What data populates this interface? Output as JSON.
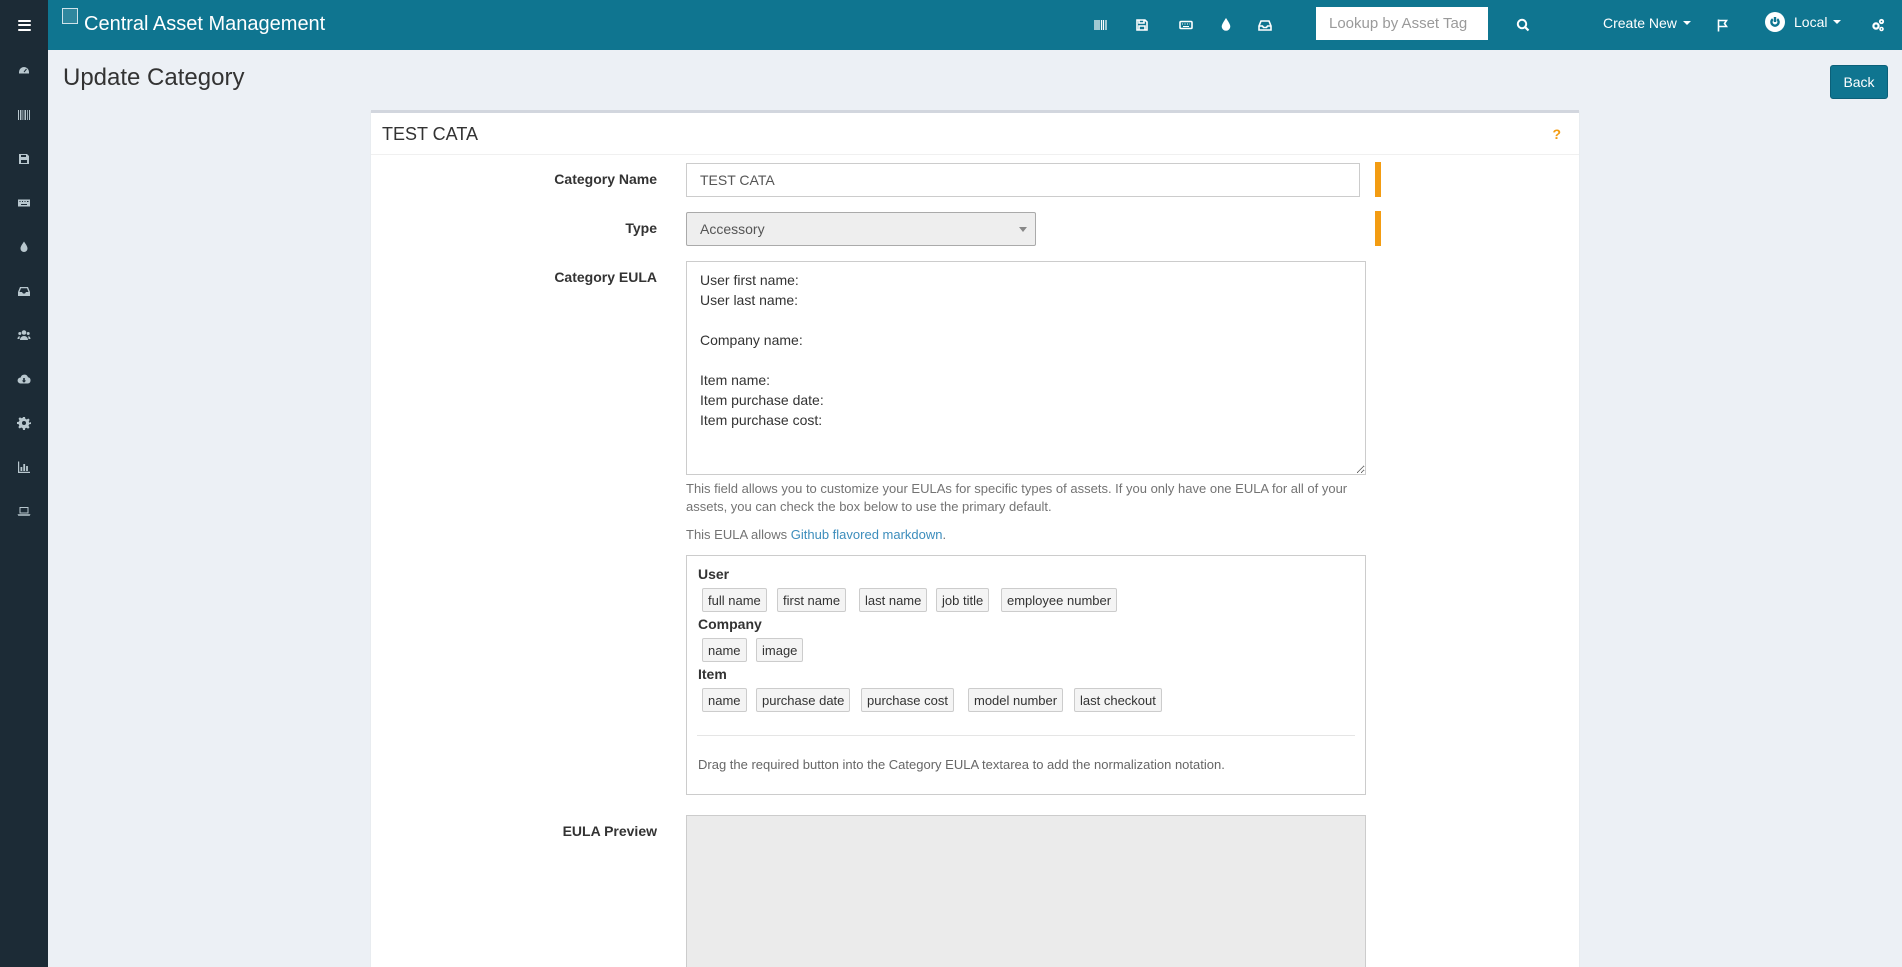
{
  "topbar": {
    "brand": "Central Asset Management",
    "icons": [
      "barcode-icon",
      "save-icon",
      "keyboard-icon",
      "tint-icon",
      "inbox-icon"
    ],
    "search": {
      "placeholder": "Lookup by Asset Tag"
    },
    "create_new": "Create New",
    "user": "Local",
    "colors": {
      "bar": "#0f7590",
      "sidebar": "#1c2b36",
      "required": "#f39c12"
    }
  },
  "sidebar": {
    "items": [
      "dashboard-icon",
      "barcode-icon",
      "save-icon",
      "keyboard-icon",
      "tint-icon",
      "inbox-icon",
      "users-icon",
      "cloud-download-icon",
      "cog-icon",
      "bar-chart-icon",
      "laptop-icon"
    ]
  },
  "page": {
    "title": "Update Category",
    "back_label": "Back"
  },
  "form": {
    "box_title": "TEST CATA",
    "help_icon": "?",
    "name_label": "Category Name",
    "name_value": "TEST CATA",
    "type_label": "Type",
    "type_value": "Accessory",
    "eula_label": "Category EULA",
    "eula_value": "User first name:\nUser last name:\n\nCompany name:\n\nItem name:\nItem purchase date:\nItem purchase cost:",
    "eula_help": "This field allows you to customize your EULAs for specific types of assets. If you only have one EULA for all of your assets, you can check the box below to use the primary default.",
    "markdown_prefix": "This EULA allows ",
    "markdown_link": "Github flavored markdown",
    "markdown_suffix": ".",
    "preview_label": "EULA Preview"
  },
  "tokens": {
    "user_heading": "User",
    "user": [
      "full name",
      "first name",
      "last name",
      "job title",
      "employee number"
    ],
    "company_heading": "Company",
    "company": [
      "name",
      "image"
    ],
    "item_heading": "Item",
    "item": [
      "name",
      "purchase date",
      "purchase cost",
      "model number",
      "last checkout"
    ],
    "note": "Drag the required button into the Category EULA textarea to add the normalization notation."
  }
}
